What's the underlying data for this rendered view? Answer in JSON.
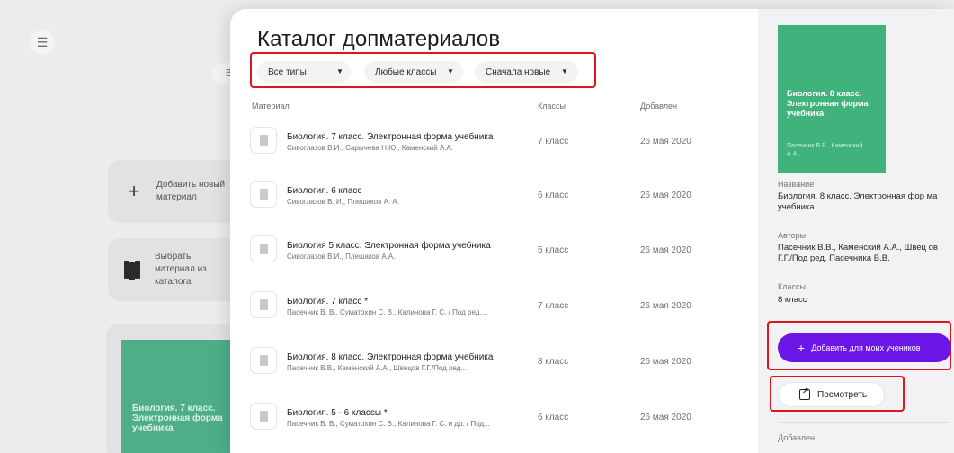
{
  "catalog": {
    "title": "Каталог допматериалов",
    "filters": {
      "type": "Все типы",
      "grades": "Любые классы",
      "sort": "Сначала новые"
    },
    "columns": {
      "material": "Материал",
      "grades": "Классы",
      "added": "Добавлен"
    },
    "rows": [
      {
        "title": "Биология. 7 класс. Электронная форма учебника",
        "authors": "Сивоглазов В.И., Сарычева Н.Ю., Каменский А.А.",
        "grade": "7 класс",
        "date": "26 мая 2020"
      },
      {
        "title": "Биология. 6 класс",
        "authors": "Сивоглазов В. И., Плешаков А. А.",
        "grade": "6 класс",
        "date": "26 мая 2020"
      },
      {
        "title": "Биология 5 класс. Электронная форма учебника",
        "authors": "Сивоглазов В.И., Плешаков А.А.",
        "grade": "5 класс",
        "date": "26 мая 2020"
      },
      {
        "title": "Биология. 7 класс *",
        "authors": "Пасечник В. В., Суматохин С. В., Калинова Г. С. / Под ред....",
        "grade": "7 класс",
        "date": "26 мая 2020"
      },
      {
        "title": "Биология. 8 класс. Электронная форма учебника",
        "authors": "Пасечник В.В., Каменский А.А., Швецов Г.Г./Под ред....",
        "grade": "8 класс",
        "date": "26 мая 2020"
      },
      {
        "title": "Биология. 5 - 6 классы *",
        "authors": "Пасечник В. В., Суматохин С. В., Калинова Г. С. и др. / Под...",
        "grade": "6 класс",
        "date": "26 мая 2020"
      }
    ]
  },
  "details": {
    "cover_title": "Биология. 8 класс. Электронная форма учебника",
    "cover_authors": "Пасечник В.В., Каменский А.А.,...",
    "name_label": "Название",
    "name_value": "Биология. 8 класс. Электронная фор ма учебника",
    "authors_label": "Авторы",
    "authors_value": "Пасечник В.В., Каменский А.А., Швец ов Г.Г./Под ред. Пасечника В.В.",
    "grades_label": "Классы",
    "grades_value": "8 класс",
    "add_button": "Добавить для моих учеников",
    "view_button": "Посмотреть",
    "added_label": "Добавлен"
  },
  "background": {
    "add_new_card": "Добавить новый материал",
    "choose_card": "Выбрать материал из каталога",
    "cover_text": "Биология. 7 класс. Электронная форма учебника",
    "chip_letter": "В"
  }
}
